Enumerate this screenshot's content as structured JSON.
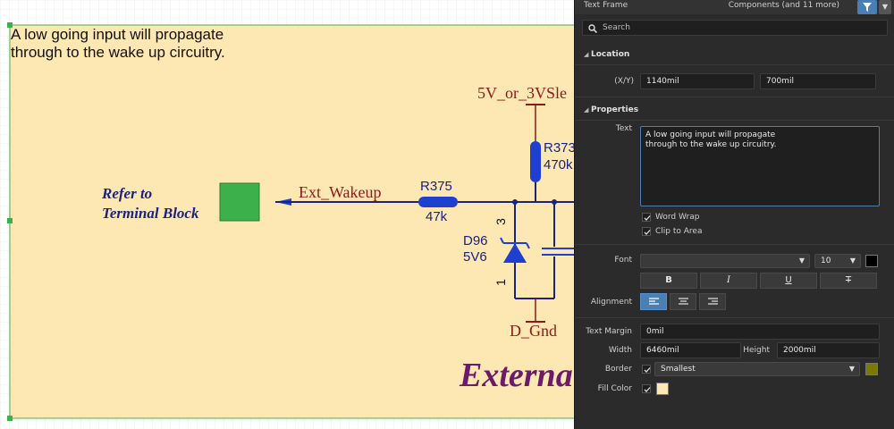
{
  "schematic": {
    "text_frame": "A low going input will propagate\nthrough to the wake up circuitry.",
    "refer_line1": "Refer to",
    "refer_line2": "Terminal Block",
    "net_ext_wakeup": "Ext_Wakeup",
    "net_5v": "5V_or_3VSle",
    "net_dgnd": "D_Gnd",
    "r375_name": "R375",
    "r375_value": "47k",
    "r373_name": "R373",
    "r373_value": "470k",
    "d96_name": "D96",
    "d96_value": "5V6",
    "pin3": "3",
    "pin1": "1",
    "title_fragment": "Externa",
    "colors": {
      "frame_fill": "#fde7b3",
      "frame_border": "#4caf50",
      "wire": "#1a237e",
      "component": "#1f3fd1",
      "port_fill": "#3cb04a",
      "power_symbol": "#8b1a1a"
    }
  },
  "panel": {
    "title": "Text Frame",
    "filter_text": "Components (and 11 more)",
    "filter_icon": "funnel-icon",
    "search_placeholder": "Search",
    "location": {
      "header": "Location",
      "xy_label": "(X/Y)",
      "x": "1140mil",
      "y": "700mil"
    },
    "properties": {
      "header": "Properties",
      "text_label": "Text",
      "text_value": "A low going input will propagate\nthrough to the wake up circuitry.",
      "word_wrap": "Word Wrap",
      "word_wrap_checked": true,
      "clip_to_area": "Clip to Area",
      "clip_to_area_checked": true,
      "font_label": "Font",
      "font_name": "",
      "font_size": "10",
      "font_color": "#000000",
      "bold": "B",
      "italic": "I",
      "underline": "U",
      "strike": "T",
      "alignment_label": "Alignment",
      "alignment_selected": "left",
      "text_margin_label": "Text Margin",
      "text_margin": "0mil",
      "width_label": "Width",
      "width": "6460mil",
      "height_label": "Height",
      "height": "2000mil",
      "border_label": "Border",
      "border_checked": true,
      "border_value": "Smallest",
      "border_color": "#7a7a00",
      "fill_label": "Fill Color",
      "fill_checked": true,
      "fill_color": "#fde7b3"
    }
  }
}
